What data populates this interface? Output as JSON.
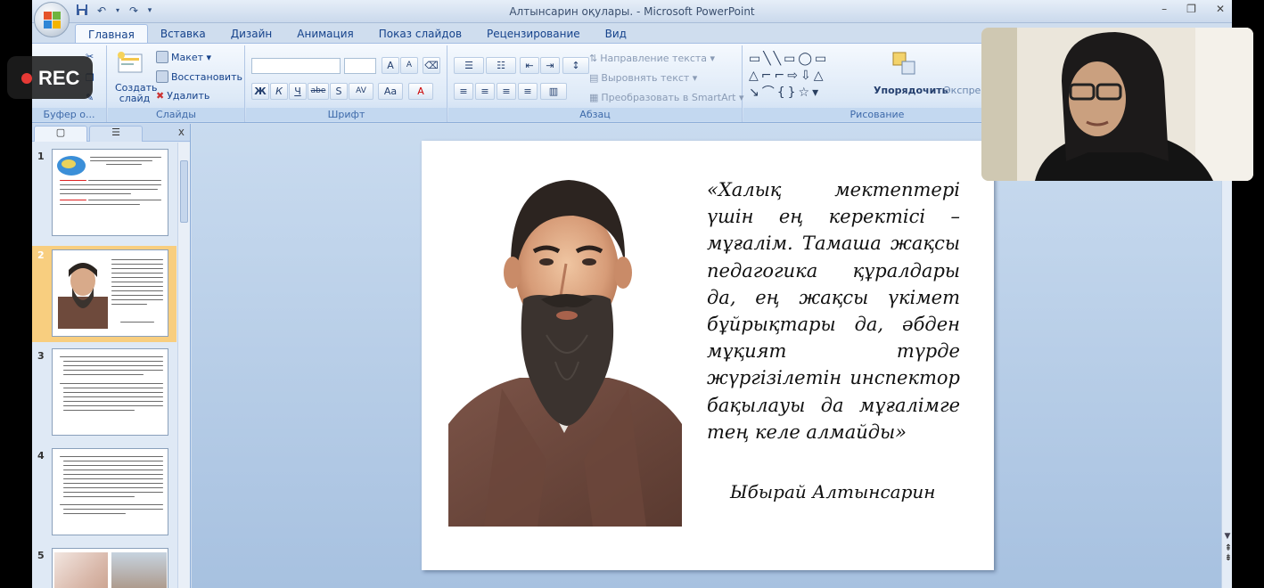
{
  "window": {
    "title": "Алтынсарин оқулары. - Microsoft PowerPoint",
    "controls": [
      "–",
      "❐",
      "✕"
    ]
  },
  "quick_access": [
    "save-icon",
    "undo-icon",
    "redo-icon",
    "customize-icon"
  ],
  "tabs": [
    {
      "label": "Главная",
      "active": true
    },
    {
      "label": "Вставка"
    },
    {
      "label": "Дизайн"
    },
    {
      "label": "Анимация"
    },
    {
      "label": "Показ слайдов"
    },
    {
      "label": "Рецензирование"
    },
    {
      "label": "Вид"
    }
  ],
  "ribbon": {
    "clipboard": {
      "label": "Буфер о..."
    },
    "slides": {
      "label": "Слайды",
      "create_slide": "Создать слайд",
      "layout": "Макет",
      "reset": "Восстановить",
      "delete": "Удалить"
    },
    "font": {
      "label": "Шрифт",
      "bold": "Ж",
      "italic": "К",
      "underline": "Ч",
      "strike": "abe",
      "shadow": "S",
      "spacing": "AV",
      "case": "Aa",
      "color": "A",
      "grow": "A",
      "shrink": "A"
    },
    "paragraph": {
      "label": "Абзац",
      "text_direction": "Направление текста",
      "align_text": "Выровнять текст",
      "smartart": "Преобразовать в SmartArt"
    },
    "drawing": {
      "label": "Рисование",
      "arrange": "Упорядочить",
      "quick_styles": "Экспресс"
    }
  },
  "pane": {
    "slides_tab_icon": "slides-icon",
    "outline_tab_icon": "outline-icon",
    "close": "x",
    "slides": [
      {
        "number": "1"
      },
      {
        "number": "2",
        "selected": true
      },
      {
        "number": "3"
      },
      {
        "number": "4"
      },
      {
        "number": "5"
      }
    ]
  },
  "slide": {
    "quote": "«Халық мектептері үшін ең керектісі – мұғалім. Тамаша жақсы педагогика құралдары да, ең жақсы үкімет бұйрықтары да, әбден мұқият түрде жүргізілетін инспектор бақылауы да мұғалімге тең келе алмайды»",
    "author": "Ыбырай Алтынсарин"
  },
  "recording": {
    "label": "REC",
    "dot_color": "#e53935"
  },
  "colors": {
    "ribbon_label": "#3e6aaa",
    "selected_slide": "#f8ce7f",
    "tab_text": "#15428b"
  }
}
